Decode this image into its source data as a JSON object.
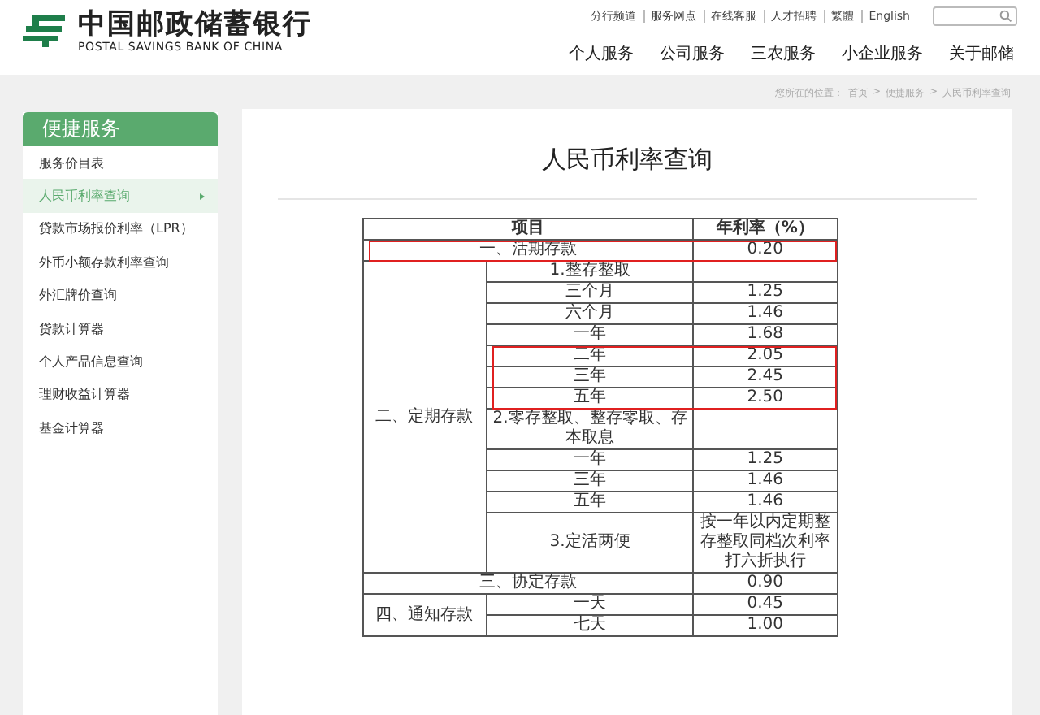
{
  "header": {
    "logo_cn": "中国邮政储蓄银行",
    "logo_en": "POSTAL SAVINGS BANK OF CHINA",
    "top_links": [
      "分行频道",
      "服务网点",
      "在线客服",
      "人才招聘",
      "繁體",
      "English"
    ],
    "nav": [
      "个人服务",
      "公司服务",
      "三农服务",
      "小企业服务",
      "关于邮储"
    ]
  },
  "breadcrumb": {
    "label": "您所在的位置：",
    "separator": ">",
    "items": [
      "首页",
      "便捷服务",
      "人民币利率查询"
    ]
  },
  "sidebar": {
    "title": "便捷服务",
    "items": [
      {
        "label": "服务价目表",
        "selected": false
      },
      {
        "label": "人民币利率查询",
        "selected": true
      },
      {
        "label": "贷款市场报价利率（LPR）",
        "selected": false
      },
      {
        "label": "外币小额存款利率查询",
        "selected": false
      },
      {
        "label": "外汇牌价查询",
        "selected": false
      },
      {
        "label": "贷款计算器",
        "selected": false
      },
      {
        "label": "个人产品信息查询",
        "selected": false
      },
      {
        "label": "理财收益计算器",
        "selected": false
      },
      {
        "label": "基金计算器",
        "selected": false
      }
    ]
  },
  "page_title": "人民币利率查询",
  "rate_table": {
    "columns": [
      "项目",
      "年利率（%）"
    ],
    "rows": [
      {
        "kind": "single",
        "label": "一、活期存款",
        "rate": "0.20",
        "highlighted": true
      },
      {
        "kind": "group",
        "label": "二、定期存款",
        "items": [
          {
            "label": "1.整存整取",
            "highlighted": false
          },
          {
            "label": "三个月",
            "rate": "1.25",
            "highlighted": false
          },
          {
            "label": "六个月",
            "rate": "1.46",
            "highlighted": false
          },
          {
            "label": "一年",
            "rate": "1.68",
            "highlighted": false
          },
          {
            "label": "二年",
            "rate": "2.05",
            "highlighted": true
          },
          {
            "label": "三年",
            "rate": "2.45",
            "highlighted": true
          },
          {
            "label": "五年",
            "rate": "2.50",
            "highlighted": true
          },
          {
            "label": "2.零存整取、整存零取、存本取息",
            "highlighted": false
          },
          {
            "label": "一年",
            "rate": "1.25",
            "highlighted": false
          },
          {
            "label": "三年",
            "rate": "1.46",
            "highlighted": false
          },
          {
            "label": "五年",
            "rate": "1.46",
            "highlighted": false
          },
          {
            "label": "3.定活两便",
            "rate": "按一年以内定期整存整取同档次利率打六折执行",
            "highlighted": false
          }
        ]
      },
      {
        "kind": "single",
        "label": "三、协定存款",
        "rate": "0.90",
        "highlighted": false
      },
      {
        "kind": "group",
        "label": "四、通知存款",
        "items": [
          {
            "label": "一天",
            "rate": "0.45",
            "highlighted": false
          },
          {
            "label": "七天",
            "rate": "1.00",
            "highlighted": false
          }
        ]
      }
    ]
  }
}
